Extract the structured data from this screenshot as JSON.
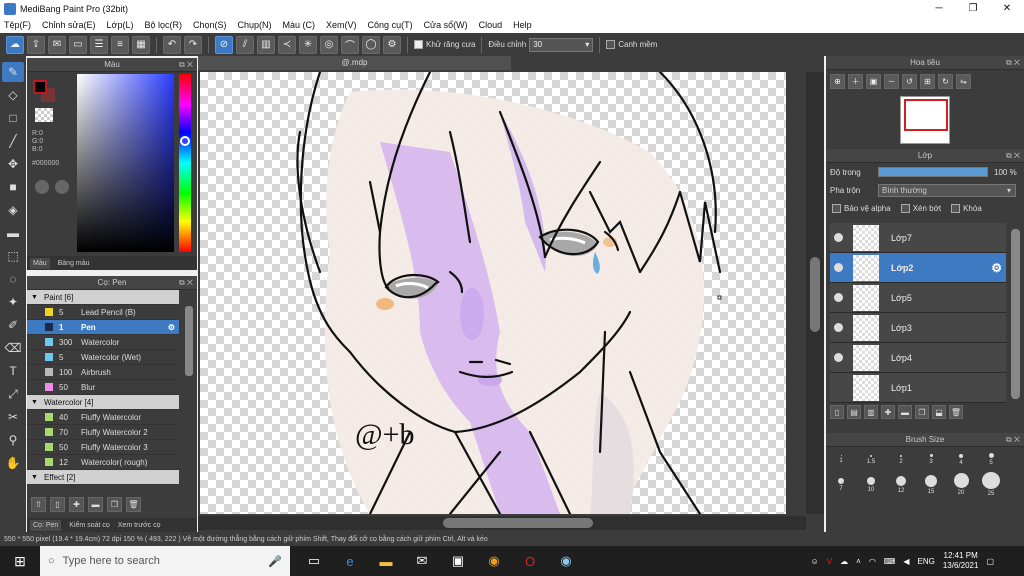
{
  "app": {
    "title": "MediBang Paint Pro (32bit)"
  },
  "menu": [
    "Tệp(F)",
    "Chỉnh sửa(E)",
    "Lớp(L)",
    "Bộ lọc(R)",
    "Chọn(S)",
    "Chụp(N)",
    "Màu (C)",
    "Xem(V)",
    "Công cụ(T)",
    "Cửa sổ(W)",
    "Cloud",
    "Help"
  ],
  "toolbar": {
    "antialias_label": "Khử răng cưa",
    "adjust_label": "Điều chỉnh",
    "adjust_value": "30",
    "snap_label": "Canh mềm"
  },
  "color_panel": {
    "title": "Màu",
    "r": "R:0",
    "g": "G:0",
    "b": "B:0",
    "hex": "#000000",
    "tabs": [
      "Màu",
      "Bảng màu"
    ],
    "colors": {
      "primary": "#000000",
      "secondary": "#c0181e"
    }
  },
  "brush_panel": {
    "title": "Cọ: Pen",
    "groups": [
      {
        "name": "Paint [6]",
        "items": [
          {
            "size": "5",
            "name": "Lead Pencil (B)",
            "color": "#f2d41c"
          },
          {
            "size": "1",
            "name": "Pen",
            "color": "#1a2a4a",
            "selected": true
          },
          {
            "size": "300",
            "name": "Watercolor",
            "color": "#6ec8f0"
          },
          {
            "size": "5",
            "name": "Watercolor (Wet)",
            "color": "#6ec8f0"
          },
          {
            "size": "100",
            "name": "Airbrush",
            "color": "#bbbbbb"
          },
          {
            "size": "50",
            "name": "Blur",
            "color": "#f08ce8"
          }
        ]
      },
      {
        "name": "Watercolor [4]",
        "items": [
          {
            "size": "40",
            "name": "Fluffy Watercolor",
            "color": "#a8d870"
          },
          {
            "size": "70",
            "name": "Fluffy Watercolor 2",
            "color": "#a8d870"
          },
          {
            "size": "50",
            "name": "Fluffy Watercolor 3",
            "color": "#a8d870"
          },
          {
            "size": "12",
            "name": "Watercolor( rough)",
            "color": "#a8d870"
          }
        ]
      },
      {
        "name": "Effect [2]",
        "items": []
      }
    ],
    "tabs": [
      "Cọ: Pen",
      "Kiểm soát cọ",
      "Xem trước cọ"
    ]
  },
  "document": {
    "tab": "@.mdp",
    "signature": "@+b"
  },
  "navigator": {
    "title": "Hoa tiêu"
  },
  "layer_panel": {
    "title": "Lớp",
    "opacity_label": "Độ trong",
    "opacity_value": "100 %",
    "opacity_fraction": 1.0,
    "blend_label": "Pha trộn",
    "blend_value": "Bình thường",
    "protect_alpha": "Bảo vệ alpha",
    "clipping": "Xén bớt",
    "lock": "Khóa",
    "layers": [
      {
        "name": "Lớp7",
        "visible": true,
        "selected": false
      },
      {
        "name": "Lớp2",
        "visible": true,
        "selected": true
      },
      {
        "name": "Lớp5",
        "visible": true,
        "selected": false
      },
      {
        "name": "Lớp3",
        "visible": true,
        "selected": false
      },
      {
        "name": "Lớp4",
        "visible": true,
        "selected": false
      },
      {
        "name": "Lớp1",
        "visible": false,
        "selected": false
      }
    ]
  },
  "brush_size": {
    "title": "Brush Size",
    "sizes": [
      "1",
      "1.5",
      "2",
      "3",
      "4",
      "5",
      "7",
      "10",
      "12",
      "15",
      "20",
      "25"
    ]
  },
  "status": {
    "text": "550 * 550 pixel  (19.4 * 19.4cm)  72 dpi  150 %  ( 493, 222 )  Vẽ một đường thẳng bằng cách giữ phím Shift, Thay đổi cỡ cọ bằng cách giữ phím Ctrl, Alt và kéo"
  },
  "taskbar": {
    "search_placeholder": "Type here to search",
    "lang": "ENG",
    "time": "12:41 PM",
    "date": "13/6/2021"
  }
}
